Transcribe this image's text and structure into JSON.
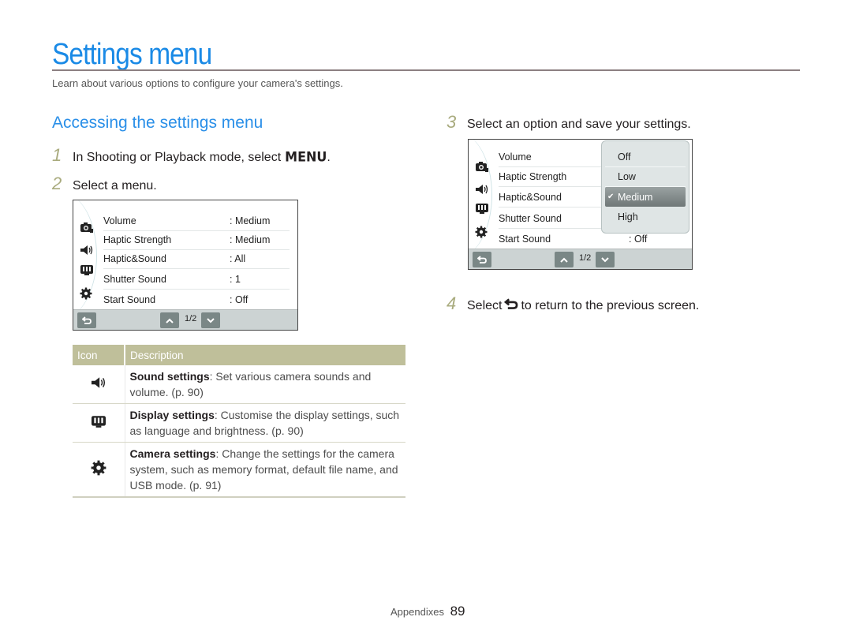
{
  "page": {
    "title": "Settings menu",
    "subtitle": "Learn about various options to configure your camera's settings.",
    "section_title": "Accessing the settings menu"
  },
  "steps": [
    {
      "num": "1",
      "text": "In Shooting or Playback mode, select",
      "glyph": "MENU",
      "suffix": "."
    },
    {
      "num": "2",
      "text": "Select a menu."
    },
    {
      "num": "3",
      "text": "Select an option and save your settings."
    },
    {
      "num": "4",
      "text_before": "Select",
      "icon": "back-icon",
      "text_after": "to return to the previous screen."
    }
  ],
  "screen1": {
    "rows": [
      {
        "label": "Volume",
        "value": ": Medium"
      },
      {
        "label": "Haptic Strength",
        "value": ": Medium"
      },
      {
        "label": "Haptic&Sound",
        "value": ": All"
      },
      {
        "label": "Shutter Sound",
        "value": ": 1"
      },
      {
        "label": "Start Sound",
        "value": ": Off"
      }
    ],
    "page_indicator": "1/2",
    "side_icons": [
      "camera-settings-icon",
      "sound-icon",
      "display-icon",
      "gear-icon"
    ]
  },
  "screen2": {
    "rows": [
      {
        "label": "Volume",
        "value": ""
      },
      {
        "label": "Haptic Strength",
        "value": ""
      },
      {
        "label": "Haptic&Sound",
        "value": ""
      },
      {
        "label": "Shutter Sound",
        "value": ""
      },
      {
        "label": "Start Sound",
        "value": ": Off"
      }
    ],
    "dropdown": {
      "options": [
        "Off",
        "Low",
        "Medium",
        "High"
      ],
      "selected": "Medium"
    },
    "page_indicator": "1/2"
  },
  "table": {
    "headers": [
      "Icon",
      "Description"
    ],
    "rows": [
      {
        "icon": "sound-icon",
        "bold": "Sound settings",
        "text": ": Set various camera sounds and volume. (p. 90)"
      },
      {
        "icon": "display-icon",
        "bold": "Display settings",
        "text": ": Customise the display settings, such as language and brightness. (p. 90)"
      },
      {
        "icon": "gear-icon",
        "bold": "Camera settings",
        "text": ": Change the settings for the camera system, such as memory format, default file name, and USB mode. (p. 91)"
      }
    ]
  },
  "footer": {
    "section": "Appendixes",
    "page_number": "89"
  },
  "colors": {
    "title_blue": "#1a8ae6",
    "step_number": "#a9ab7e",
    "table_header": "#bfbf9a"
  }
}
